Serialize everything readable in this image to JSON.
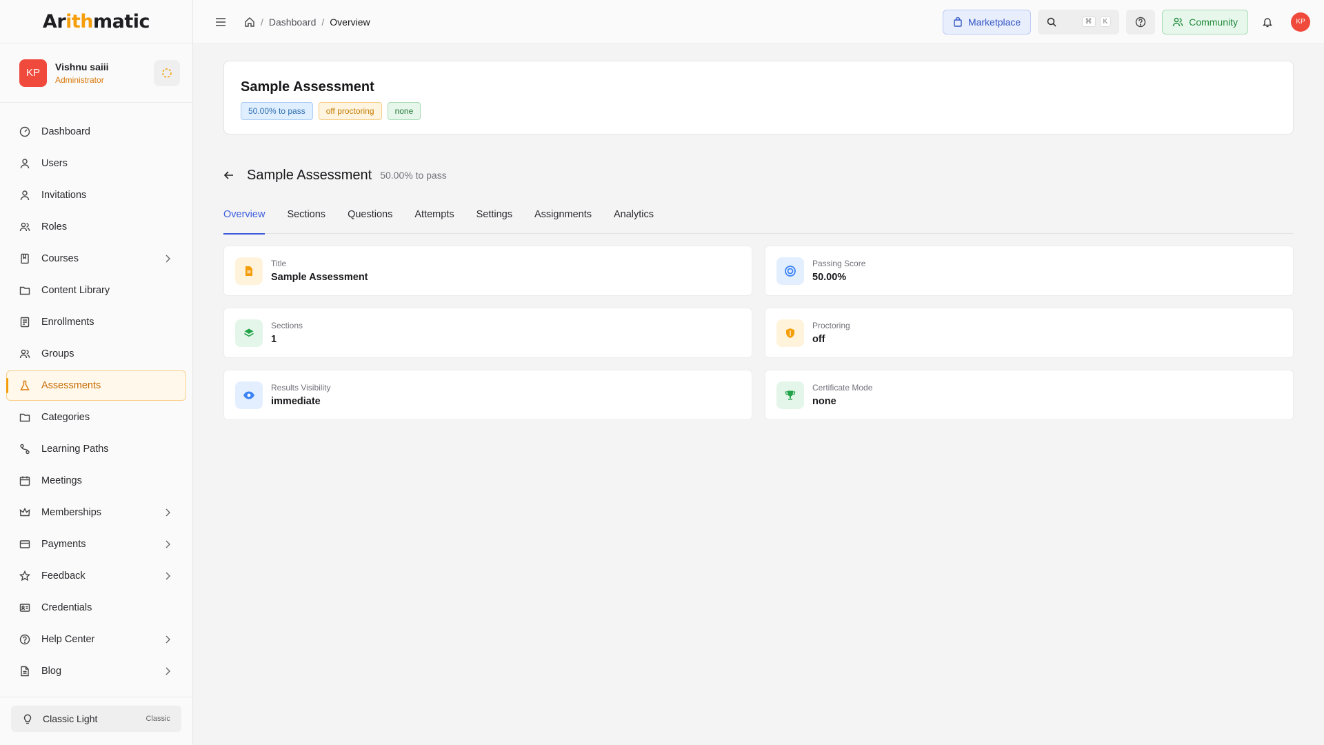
{
  "brand": {
    "name_part1": "Ar",
    "name_accent": "ith",
    "name_part2": "matic"
  },
  "user": {
    "initials": "KP",
    "name": "Vishnu saiii",
    "role": "Administrator"
  },
  "sidebar": {
    "items": [
      {
        "label": "Dashboard",
        "icon": "dashboard-icon"
      },
      {
        "label": "Users",
        "icon": "user-icon"
      },
      {
        "label": "Invitations",
        "icon": "user-icon"
      },
      {
        "label": "Roles",
        "icon": "users-icon"
      },
      {
        "label": "Courses",
        "icon": "book-icon"
      },
      {
        "label": "Content Library",
        "icon": "folder-icon"
      },
      {
        "label": "Enrollments",
        "icon": "clipboard-icon"
      },
      {
        "label": "Groups",
        "icon": "users-icon"
      },
      {
        "label": "Assessments",
        "icon": "flask-icon"
      },
      {
        "label": "Categories",
        "icon": "folder-icon"
      },
      {
        "label": "Learning Paths",
        "icon": "route-icon"
      },
      {
        "label": "Meetings",
        "icon": "calendar-icon"
      },
      {
        "label": "Memberships",
        "icon": "crown-icon"
      },
      {
        "label": "Payments",
        "icon": "credit-card-icon"
      },
      {
        "label": "Feedback",
        "icon": "star-icon"
      },
      {
        "label": "Credentials",
        "icon": "id-card-icon"
      },
      {
        "label": "Help Center",
        "icon": "help-circle-icon"
      },
      {
        "label": "Blog",
        "icon": "document-icon"
      }
    ],
    "active": "Assessments",
    "theme": {
      "label": "Classic Light",
      "tag": "Classic"
    }
  },
  "topbar": {
    "breadcrumb": [
      "Dashboard",
      "Overview"
    ],
    "marketplace_label": "Marketplace",
    "search_kbd": [
      "⌘",
      "K"
    ],
    "community_label": "Community",
    "avatar_initials": "KP"
  },
  "assessment": {
    "title": "Sample Assessment",
    "badges": [
      "50.00% to pass",
      "off proctoring",
      "none"
    ],
    "subtitle": "50.00% to pass"
  },
  "tabs": [
    "Overview",
    "Sections",
    "Questions",
    "Attempts",
    "Settings",
    "Assignments",
    "Analytics"
  ],
  "active_tab": "Overview",
  "stats": [
    {
      "label": "Title",
      "value": "Sample Assessment",
      "icon": "document-icon",
      "color": "#f59e0b"
    },
    {
      "label": "Passing Score",
      "value": "50.00%",
      "icon": "target-icon",
      "color": "#3b82f6"
    },
    {
      "label": "Sections",
      "value": "1",
      "icon": "layers-icon",
      "color": "#22a34a"
    },
    {
      "label": "Proctoring",
      "value": "off",
      "icon": "shield-icon",
      "color": "#f59e0b"
    },
    {
      "label": "Results Visibility",
      "value": "immediate",
      "icon": "eye-icon",
      "color": "#3b82f6"
    },
    {
      "label": "Certificate Mode",
      "value": "none",
      "icon": "trophy-icon",
      "color": "#22a34a"
    }
  ]
}
